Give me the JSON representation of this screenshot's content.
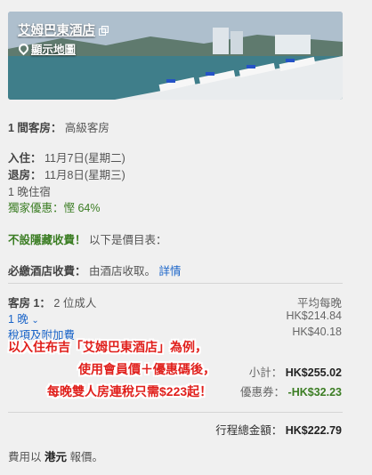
{
  "hotel": {
    "name": "艾姆巴東酒店",
    "map_link": "顯示地圖"
  },
  "room": {
    "label": "1 間客房：",
    "value": "高級客房"
  },
  "dates": {
    "checkin_label": "入住：",
    "checkin_value": "11月7日(星期二)",
    "checkout_label": "退房：",
    "checkout_value": "11月8日(星期三)",
    "nights": "1 晚住宿",
    "deal": "獨家優惠：慳 64%"
  },
  "fees": {
    "no_hidden_label": "不設隱藏收費！",
    "no_hidden_text": "以下是價目表：",
    "mandatory_label": "必繳酒店收費：",
    "mandatory_text": "由酒店收取。",
    "details_link": "詳情"
  },
  "pricing": {
    "room_line_label": "客房 1：",
    "room_line_value": "2 位成人",
    "avg_per_night": "平均每晚",
    "nights_toggle": "1 晚",
    "nights_price": "HK$214.84",
    "taxes_link": "稅項及附加費",
    "taxes_price": "HK$40.18",
    "subtotal_label": "小計：",
    "subtotal_value": "HK$255.02",
    "coupon_label": "優惠券：",
    "coupon_value": "-HK$32.23",
    "total_label": "行程總金額：",
    "total_value": "HK$222.79",
    "currency_note_pre": "費用以",
    "currency_note_bold": "港元",
    "currency_note_post": "報價。"
  },
  "promo": {
    "line1": "以入住布吉「艾姆巴東酒店」為例，",
    "line2": "使用會員價＋優惠碼後，",
    "line3": "每晚雙人房連稅只需$223起！"
  },
  "colors": {
    "accent_link": "#1a64c8",
    "deal_green": "#3b7d23",
    "promo_red": "#e0201c",
    "promo_blue": "#1c34a8"
  }
}
